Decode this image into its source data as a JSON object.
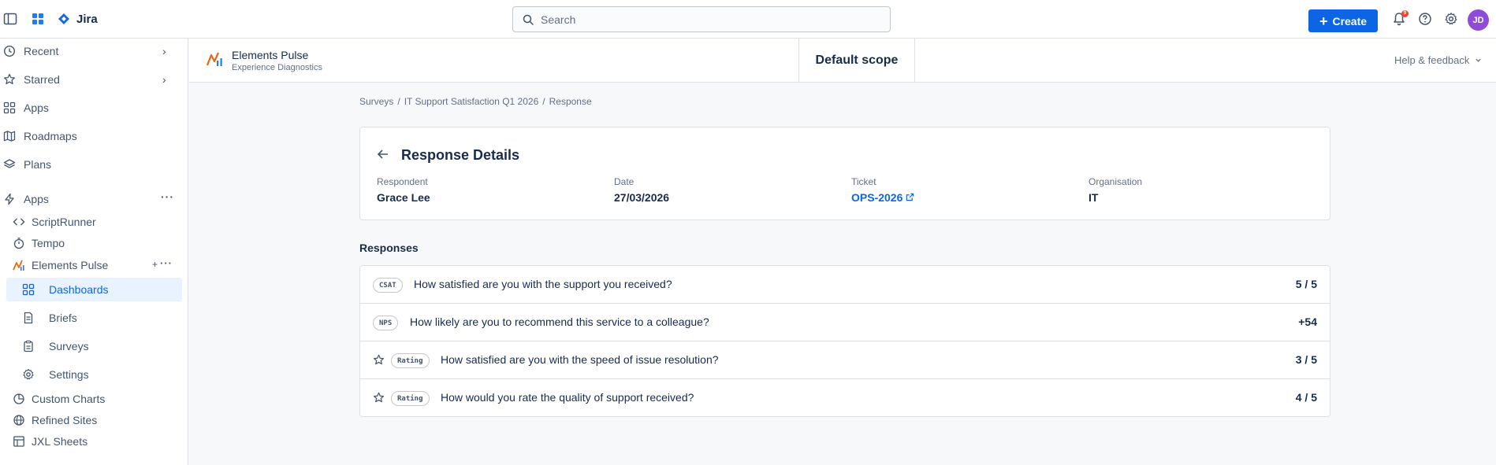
{
  "topbar": {
    "app_name": "Jira",
    "search_placeholder": "Search",
    "create_label": "Create",
    "notification_count": "9",
    "avatar_initials": "JD"
  },
  "sidebar": {
    "items": [
      {
        "label": "Recent",
        "icon": "clock-icon"
      },
      {
        "label": "Starred",
        "icon": "star-icon"
      },
      {
        "label": "Apps",
        "icon": "apps-grid-icon"
      },
      {
        "label": "Roadmaps",
        "icon": "map-icon"
      },
      {
        "label": "Plans",
        "icon": "layers-icon"
      }
    ],
    "apps_section": {
      "label": "Apps",
      "icon": "lightning-icon"
    },
    "app_items": [
      {
        "label": "ScriptRunner",
        "icon": "code-icon"
      },
      {
        "label": "Tempo",
        "icon": "stopwatch-icon"
      },
      {
        "label": "Elements Pulse",
        "icon": "pulse-logo-icon"
      }
    ],
    "pulse_sub_items": [
      {
        "label": "Dashboards",
        "icon": "dashboard-icon",
        "active": true
      },
      {
        "label": "Briefs",
        "icon": "document-icon"
      },
      {
        "label": "Surveys",
        "icon": "clipboard-icon"
      },
      {
        "label": "Settings",
        "icon": "gear-icon"
      }
    ],
    "more_items": [
      {
        "label": "Custom Charts",
        "icon": "pie-chart-icon"
      },
      {
        "label": "Refined Sites",
        "icon": "globe-icon"
      },
      {
        "label": "JXL Sheets",
        "icon": "table-icon"
      }
    ]
  },
  "app_header": {
    "name": "Elements Pulse",
    "subtitle": "Experience Diagnostics",
    "scope": "Default scope",
    "help": "Help & feedback"
  },
  "breadcrumb": [
    "Surveys",
    "IT Support Satisfaction Q1 2026",
    "Response"
  ],
  "detail": {
    "title": "Response Details",
    "fields": [
      {
        "label": "Respondent",
        "value": "Grace Lee"
      },
      {
        "label": "Date",
        "value": "27/03/2026"
      },
      {
        "label": "Ticket",
        "value": "OPS-2026"
      },
      {
        "label": "Organisation",
        "value": "IT"
      }
    ]
  },
  "responses": {
    "heading": "Responses",
    "rows": [
      {
        "type": "CSAT",
        "question": "How satisfied are you with the support you received?",
        "score": "5 / 5",
        "star": false
      },
      {
        "type": "NPS",
        "question": "How likely are you to recommend this service to a colleague?",
        "score": "+54",
        "star": false
      },
      {
        "type": "Rating",
        "question": "How satisfied are you with the speed of issue resolution?",
        "score": "3 / 5",
        "star": true
      },
      {
        "type": "Rating",
        "question": "How would you rate the quality of support received?",
        "score": "4 / 5",
        "star": true
      }
    ]
  },
  "colors": {
    "accent": "#0c66e4",
    "avatar": "#8f4cd9",
    "notification": "#e34935"
  }
}
